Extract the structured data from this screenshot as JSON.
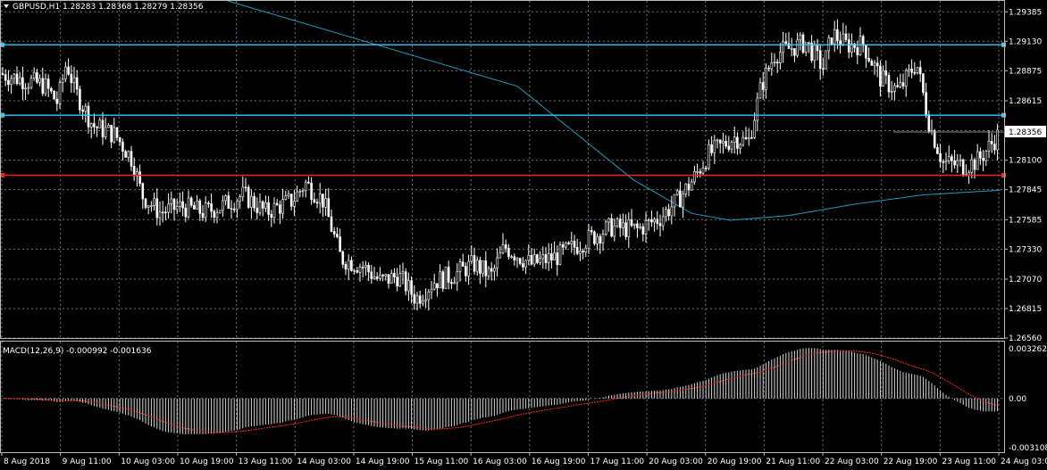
{
  "chart_data": [
    {
      "type": "candlestick",
      "symbol_label": "GBPUSD,H1",
      "ohlc_readout": [
        "1.28283",
        "1.28368",
        "1.28279",
        "1.28356"
      ],
      "current_price_label": "1.28356",
      "ylim": [
        1.2656,
        1.2948
      ],
      "y_ticks": [
        "1.29385",
        "1.29130",
        "1.28875",
        "1.28615",
        "1.28356",
        "1.28100",
        "1.27845",
        "1.27585",
        "1.27330",
        "1.27070",
        "1.26815",
        "1.26560"
      ],
      "x_ticks": [
        "8 Aug 2018",
        "9 Aug 11:00",
        "10 Aug 03:00",
        "10 Aug 19:00",
        "13 Aug 11:00",
        "14 Aug 03:00",
        "14 Aug 19:00",
        "15 Aug 11:00",
        "16 Aug 03:00",
        "16 Aug 19:00",
        "17 Aug 11:00",
        "20 Aug 03:00",
        "20 Aug 19:00",
        "21 Aug 11:00",
        "22 Aug 03:00",
        "22 Aug 19:00",
        "23 Aug 11:00",
        "24 Aug 03:00"
      ],
      "horizontal_levels": [
        {
          "price": 1.291,
          "color": "#33ccff"
        },
        {
          "price": 1.2849,
          "color": "#33ccff"
        },
        {
          "price": 1.2797,
          "color": "#ff2020"
        }
      ],
      "moving_average": {
        "color": "#1f9bbf",
        "anchors": [
          [
            0.2,
            1.3
          ],
          [
            0.5,
            1.2874
          ],
          [
            0.62,
            1.2793
          ],
          [
            0.68,
            1.2764
          ],
          [
            0.72,
            1.2758
          ],
          [
            0.78,
            1.2762
          ],
          [
            0.85,
            1.2772
          ],
          [
            0.92,
            1.278
          ],
          [
            1.0,
            1.2784
          ]
        ]
      },
      "price_path": [
        [
          0,
          1.2885
        ],
        [
          0.05,
          1.2875
        ],
        [
          0.065,
          1.286
        ],
        [
          0.075,
          1.2895
        ],
        [
          0.085,
          1.287
        ],
        [
          0.105,
          1.284
        ],
        [
          0.13,
          1.2832
        ],
        [
          0.15,
          1.281
        ],
        [
          0.16,
          1.278
        ],
        [
          0.18,
          1.2765
        ],
        [
          0.205,
          1.277
        ],
        [
          0.23,
          1.2765
        ],
        [
          0.25,
          1.277
        ],
        [
          0.275,
          1.278
        ],
        [
          0.3,
          1.2765
        ],
        [
          0.33,
          1.2775
        ],
        [
          0.345,
          1.279
        ],
        [
          0.365,
          1.2775
        ],
        [
          0.385,
          1.2725
        ],
        [
          0.41,
          1.2718
        ],
        [
          0.43,
          1.2705
        ],
        [
          0.45,
          1.271
        ],
        [
          0.47,
          1.269
        ],
        [
          0.49,
          1.2705
        ],
        [
          0.51,
          1.271
        ],
        [
          0.535,
          1.272
        ],
        [
          0.555,
          1.271
        ],
        [
          0.57,
          1.2735
        ],
        [
          0.6,
          1.272
        ],
        [
          0.63,
          1.2727
        ],
        [
          0.66,
          1.274
        ],
        [
          0.69,
          1.2752
        ],
        [
          0.72,
          1.275
        ],
        [
          0.745,
          1.276
        ],
        [
          0.765,
          1.2775
        ],
        [
          0.78,
          1.279
        ],
        [
          0.8,
          1.2815
        ],
        [
          0.83,
          1.283
        ],
        [
          0.845,
          1.2825
        ],
        [
          0.86,
          1.2875
        ],
        [
          0.875,
          1.2902
        ],
        [
          0.91,
          1.2912
        ],
        [
          0.93,
          1.289
        ],
        [
          0.94,
          1.292
        ],
        [
          0.955,
          1.291
        ],
        [
          0.975,
          1.291
        ],
        [
          0.995,
          1.288
        ],
        [
          1.015,
          1.287
        ],
        [
          1.035,
          1.2895
        ],
        [
          1.05,
          1.284
        ],
        [
          1.065,
          1.2808
        ],
        [
          1.09,
          1.2805
        ],
        [
          1.105,
          1.281
        ],
        [
          1.13,
          1.2834
        ]
      ]
    },
    {
      "type": "histogram+line",
      "indicator_label": "MACD(12,26,9) -0.000992 -0.001636",
      "y_ticks": [
        "0.003262",
        "0.00",
        "-0.003108"
      ],
      "ylim": [
        -0.0034,
        0.0036
      ],
      "histogram_color": "#d8d8d8",
      "signal_color": "#ff2a2a"
    }
  ]
}
